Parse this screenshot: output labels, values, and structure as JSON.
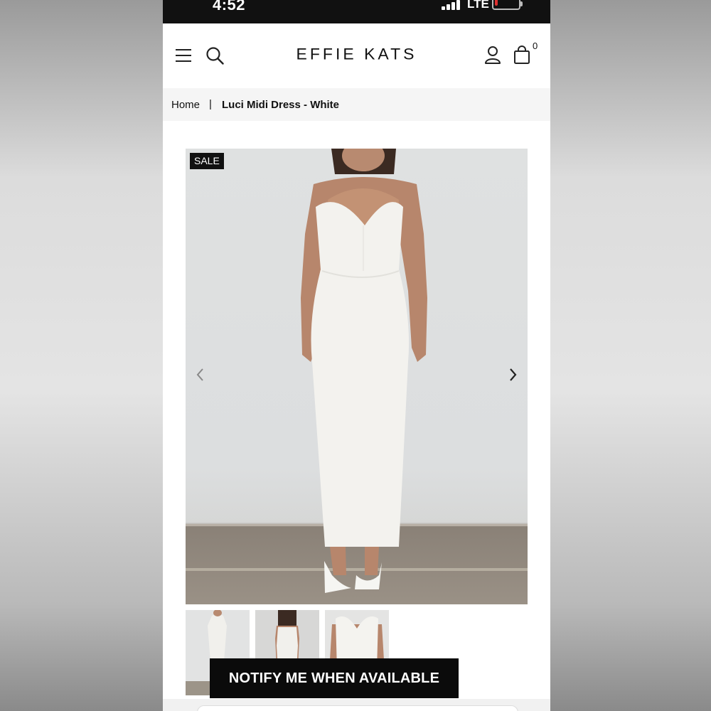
{
  "status_bar": {
    "time": "4:52",
    "network": "LTE"
  },
  "header": {
    "logo": "EFFIE KATS",
    "cart_count": "0",
    "icons": [
      "menu-icon",
      "search-icon",
      "user-icon",
      "cart-icon"
    ]
  },
  "breadcrumb": {
    "home": "Home",
    "separator": "|",
    "current": "Luci Midi Dress - White"
  },
  "product": {
    "badge": "SALE",
    "gallery_icons": [
      "chevron-left-icon",
      "chevron-right-icon"
    ],
    "thumbnail_count": 3,
    "notify_label": "NOTIFY ME WHEN AVAILABLE"
  },
  "colors": {
    "status_bar": "#111111",
    "badge_bg": "#000000",
    "button_bg": "#0b0b0b",
    "battery_low": "#e03030"
  }
}
